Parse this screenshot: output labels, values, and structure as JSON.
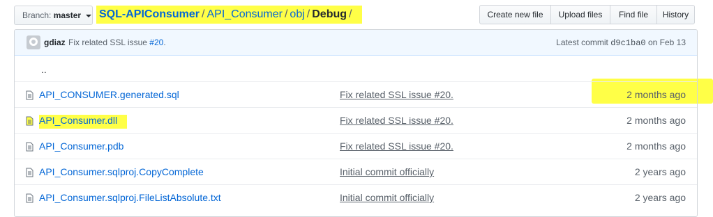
{
  "header": {
    "branch_label": "Branch:",
    "branch_name": "master",
    "breadcrumb": {
      "repo": "SQL-APIConsumer",
      "path1": "API_Consumer",
      "path2": "obj",
      "current": "Debug",
      "trailing_sep": "/"
    },
    "buttons": [
      "Create new file",
      "Upload files",
      "Find file",
      "History"
    ]
  },
  "commit": {
    "author": "gdiaz",
    "message": "Fix related SSL issue",
    "issue_link": "#20",
    "message_end": ".",
    "latest_label": "Latest commit",
    "sha": "d9c1ba0",
    "date": "on Feb 13"
  },
  "up_dir": "..",
  "files": [
    {
      "name": "API_CONSUMER.generated.sql",
      "message": "Fix related SSL issue #20.",
      "age": "2 months ago"
    },
    {
      "name": "API_Consumer.dll",
      "message": "Fix related SSL issue #20.",
      "age": "2 months ago"
    },
    {
      "name": "API_Consumer.pdb",
      "message": "Fix related SSL issue #20.",
      "age": "2 months ago"
    },
    {
      "name": "API_Consumer.sqlproj.CopyComplete",
      "message": "Initial commit officially",
      "age": "2 years ago"
    },
    {
      "name": "API_Consumer.sqlproj.FileListAbsolute.txt",
      "message": "Initial commit officially",
      "age": "2 years ago"
    }
  ],
  "colors": {
    "highlight": "#ffff47",
    "link": "#0366d6",
    "commit_bg": "#f1f8ff"
  }
}
